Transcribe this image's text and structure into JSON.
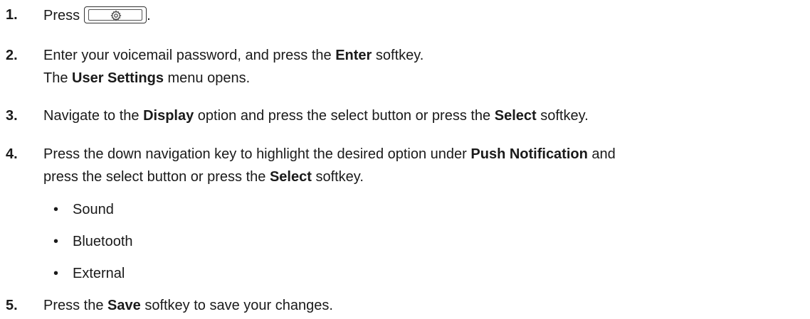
{
  "steps": [
    {
      "number": "1.",
      "segments": [
        "Press",
        "."
      ],
      "key_icon": "gear-icon"
    },
    {
      "number": "2.",
      "line1": [
        "Enter your voicemail password, and press the ",
        "Enter",
        " softkey."
      ],
      "line2": [
        "The ",
        "User Settings",
        " menu opens."
      ]
    },
    {
      "number": "3.",
      "line1": [
        "Navigate to the ",
        "Display",
        " option and press the select button or press the ",
        "Select",
        " softkey."
      ]
    },
    {
      "number": "4.",
      "line1": [
        "Press the down navigation key to highlight the desired option under ",
        "Push Notification",
        " and"
      ],
      "line2": [
        "press the select button or press the ",
        "Select",
        " softkey."
      ],
      "bullets": [
        "Sound",
        "Bluetooth",
        "External"
      ],
      "bullet_symbol": "•"
    },
    {
      "number": "5.",
      "line1": [
        "Press the ",
        "Save",
        " softkey to save your changes."
      ]
    }
  ]
}
